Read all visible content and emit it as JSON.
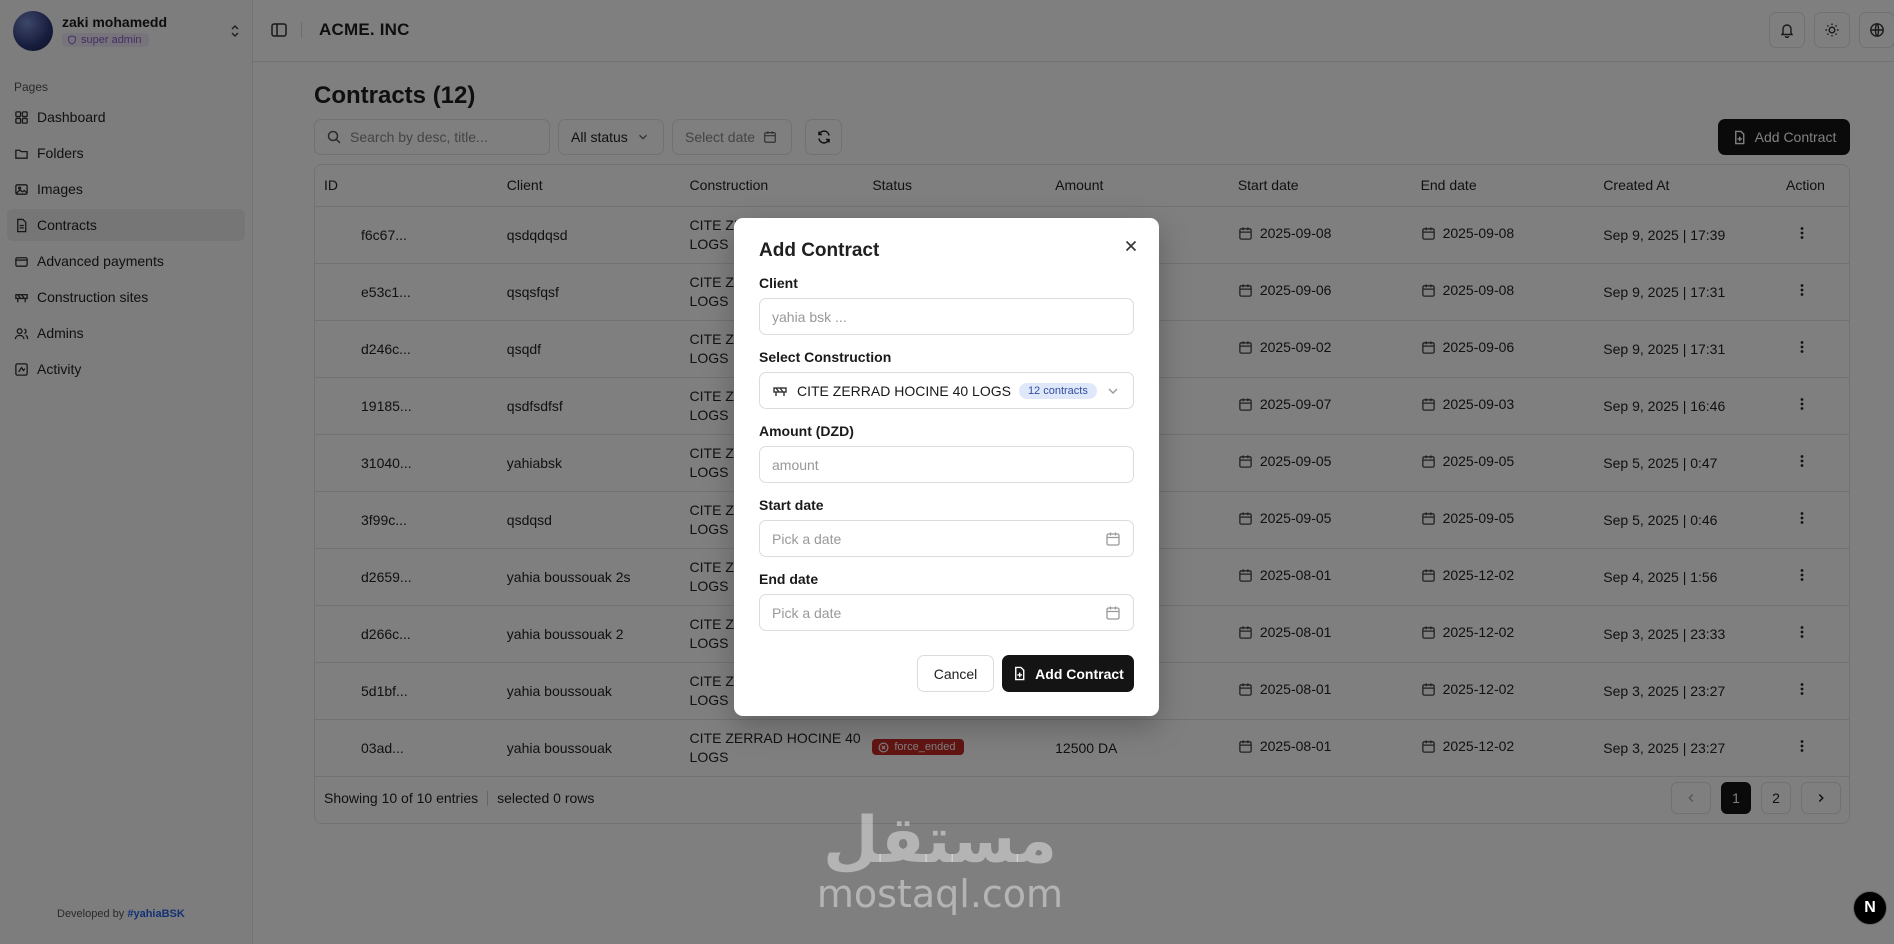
{
  "user": {
    "name": "zaki mohamedd",
    "role": "super admin"
  },
  "sidebar": {
    "heading": "Pages",
    "items": [
      {
        "label": "Dashboard",
        "icon": "grid-icon"
      },
      {
        "label": "Folders",
        "icon": "folder-icon"
      },
      {
        "label": "Images",
        "icon": "image-icon"
      },
      {
        "label": "Contracts",
        "icon": "file-icon",
        "active": true
      },
      {
        "label": "Advanced payments",
        "icon": "wallet-icon"
      },
      {
        "label": "Construction sites",
        "icon": "construction-icon"
      },
      {
        "label": "Admins",
        "icon": "users-icon"
      },
      {
        "label": "Activity",
        "icon": "activity-icon"
      }
    ],
    "footer_prefix": "Developed by",
    "footer_link": "#yahiaBSK"
  },
  "header": {
    "brand": "ACME. INC"
  },
  "main": {
    "title": "Contracts (12)",
    "search_placeholder": "Search by desc, title...",
    "status_filter": "All status",
    "date_filter": "Select date",
    "add_button": "Add Contract"
  },
  "table": {
    "columns": [
      "ID",
      "Client",
      "Construction",
      "Status",
      "Amount",
      "Start date",
      "End date",
      "Created At",
      "Action"
    ],
    "construction_prefix": "CITE ZE",
    "construction_line2": "LOGS",
    "rows": [
      {
        "id": "f6c67...",
        "client": "qsdqdqsd",
        "start": "2025-09-08",
        "end": "2025-09-08",
        "created": "Sep 9, 2025 | 17:39"
      },
      {
        "id": "e53c1...",
        "client": "qsqsfqsf",
        "start": "2025-09-06",
        "end": "2025-09-08",
        "created": "Sep 9, 2025 | 17:31"
      },
      {
        "id": "d246c...",
        "client": "qsqdf",
        "start": "2025-09-02",
        "end": "2025-09-06",
        "created": "Sep 9, 2025 | 17:31"
      },
      {
        "id": "19185...",
        "client": "qsdfsdfsf",
        "start": "2025-09-07",
        "end": "2025-09-03",
        "created": "Sep 9, 2025 | 16:46"
      },
      {
        "id": "31040...",
        "client": "yahiabsk",
        "start": "2025-09-05",
        "end": "2025-09-05",
        "created": "Sep 5, 2025 | 0:47"
      },
      {
        "id": "3f99c...",
        "client": "qsdqsd",
        "start": "2025-09-05",
        "end": "2025-09-05",
        "created": "Sep 5, 2025 | 0:46"
      },
      {
        "id": "d2659...",
        "client": "yahia boussouak 2s",
        "start": "2025-08-01",
        "end": "2025-12-02",
        "created": "Sep 4, 2025 | 1:56"
      },
      {
        "id": "d266c...",
        "client": "yahia boussouak 2",
        "start": "2025-08-01",
        "end": "2025-12-02",
        "created": "Sep 3, 2025 | 23:33"
      },
      {
        "id": "5d1bf...",
        "client": "yahia boussouak",
        "start": "2025-08-01",
        "end": "2025-12-02",
        "created": "Sep 3, 2025 | 23:27"
      },
      {
        "id": "03ad...",
        "client": "yahia boussouak",
        "construction": "CITE ZERRAD HOCINE 40",
        "status": "force_ended",
        "amount": "12500 DA",
        "start": "2025-08-01",
        "end": "2025-12-02",
        "created": "Sep 3, 2025 | 23:27"
      }
    ],
    "footer_showing": "Showing 10 of 10 entries",
    "footer_selected": "selected 0 rows",
    "pages": [
      "1",
      "2"
    ]
  },
  "modal": {
    "title": "Add Contract",
    "client_label": "Client",
    "client_placeholder": "yahia bsk ...",
    "construction_label": "Select Construction",
    "construction_value": "CITE ZERRAD HOCINE 40 LOGS",
    "construction_badge": "12 contracts",
    "amount_label": "Amount (DZD)",
    "amount_placeholder": "amount",
    "start_label": "Start date",
    "start_placeholder": "Pick a date",
    "end_label": "End date",
    "end_placeholder": "Pick a date",
    "cancel": "Cancel",
    "submit": "Add Contract"
  },
  "watermark": {
    "arabic": "مستقل",
    "latin": "mostaql.com"
  },
  "corner_badge": "N",
  "colors": {
    "status_force_ended": "#c42a26",
    "primary": "#141414",
    "role_badge": "#8a5cc9"
  }
}
